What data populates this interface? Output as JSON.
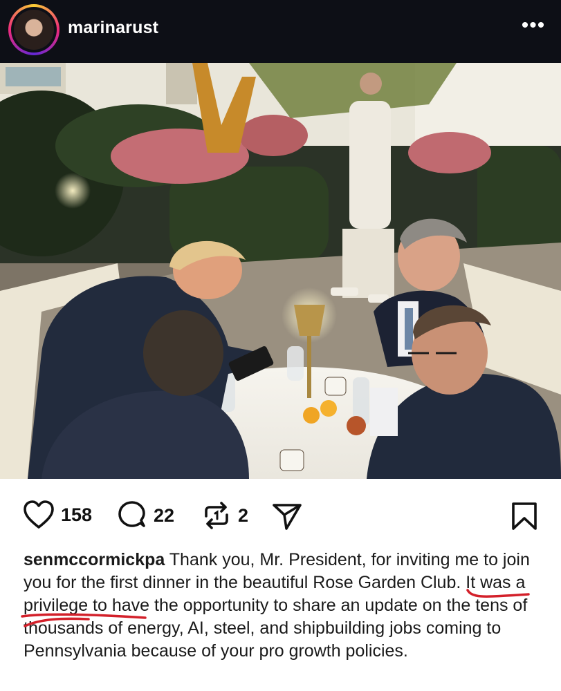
{
  "header": {
    "username": "marinarust",
    "more_label": "•••"
  },
  "photo": {
    "alt": ""
  },
  "actions": {
    "likes": "158",
    "comments": "22",
    "reposts": "2"
  },
  "caption": {
    "author": "senmccormickpa",
    "text": " Thank you, Mr. President, for inviting me to join you for the first dinner in the beautiful Rose Garden Club. It was a privilege to have the opportunity to share an update on the tens of thousands of energy, AI, steel, and shipbuilding jobs coming to Pennsylvania because of your pro growth policies."
  },
  "colors": {
    "header_bg": "#0d0f16",
    "annotation_red": "#d3202a"
  }
}
